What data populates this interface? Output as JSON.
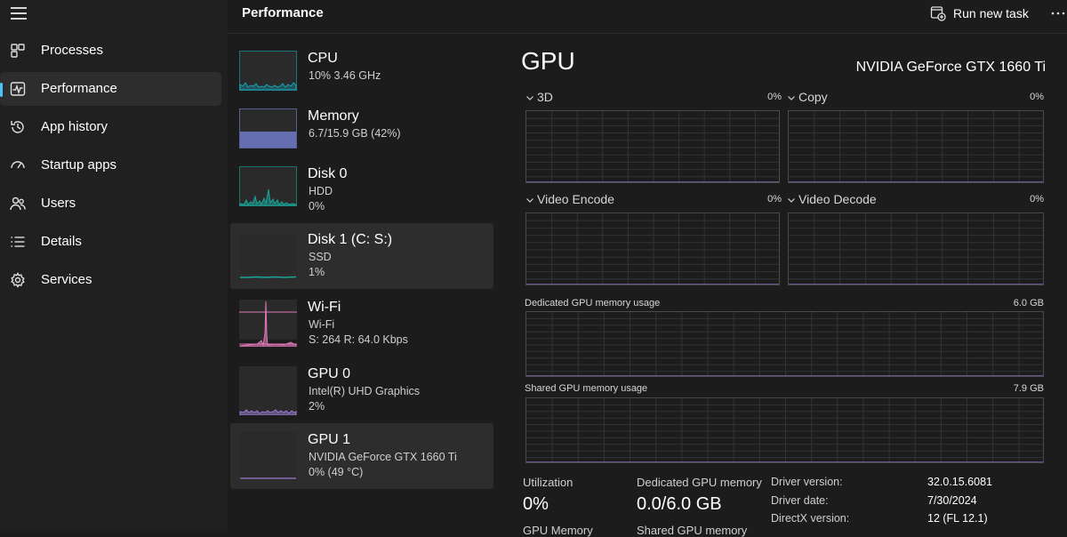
{
  "header": {
    "title": "Performance",
    "run_task_label": "Run new task"
  },
  "nav": {
    "items": [
      {
        "label": "Processes",
        "icon": "processes-icon"
      },
      {
        "label": "Performance",
        "icon": "performance-icon",
        "active": true
      },
      {
        "label": "App history",
        "icon": "app-history-icon"
      },
      {
        "label": "Startup apps",
        "icon": "startup-apps-icon"
      },
      {
        "label": "Users",
        "icon": "users-icon"
      },
      {
        "label": "Details",
        "icon": "details-icon"
      },
      {
        "label": "Services",
        "icon": "services-icon"
      }
    ]
  },
  "devices": [
    {
      "name": "CPU",
      "line1": "10%  3.46 GHz",
      "line2": "",
      "color": "#17a3b8"
    },
    {
      "name": "Memory",
      "line1": "6.7/15.9 GB (42%)",
      "line2": "",
      "color": "#7b86e0",
      "usage_fraction": 0.42
    },
    {
      "name": "Disk 0",
      "line1": "HDD",
      "line2": "0%",
      "color": "#1aa59a"
    },
    {
      "name": "Disk 1 (C: S:)",
      "line1": "SSD",
      "line2": "1%",
      "color": "#1aa59a",
      "selected_style": true
    },
    {
      "name": "Wi-Fi",
      "line1": "Wi-Fi",
      "line2": "S: 264  R: 64.0 Kbps",
      "color": "#e079b8"
    },
    {
      "name": "GPU 0",
      "line1": "Intel(R) UHD Graphics",
      "line2": "2%",
      "color": "#9a7ad0"
    },
    {
      "name": "GPU 1",
      "line1": "NVIDIA GeForce GTX 1660 Ti",
      "line2": "0%  (49 °C)",
      "color": "#9a7ad0",
      "active": true
    }
  ],
  "detail": {
    "title": "GPU",
    "model": "NVIDIA GeForce GTX 1660 Ti",
    "engines": [
      {
        "label": "3D",
        "percent": "0%"
      },
      {
        "label": "Copy",
        "percent": "0%"
      },
      {
        "label": "Video Encode",
        "percent": "0%"
      },
      {
        "label": "Video Decode",
        "percent": "0%"
      }
    ],
    "dedicated": {
      "label": "Dedicated GPU memory usage",
      "max": "6.0 GB"
    },
    "shared": {
      "label": "Shared GPU memory usage",
      "max": "7.9 GB"
    },
    "stats": {
      "utilization_label": "Utilization",
      "utilization_value": "0%",
      "dedicated_label": "Dedicated GPU memory",
      "dedicated_value": "0.0/6.0 GB",
      "gpu_memory_label": "GPU Memory",
      "shared_memory_label": "Shared GPU memory"
    },
    "info": [
      {
        "key": "Driver version:",
        "value": "32.0.15.6081"
      },
      {
        "key": "Driver date:",
        "value": "7/30/2024"
      },
      {
        "key": "DirectX version:",
        "value": "12 (FL 12.1)"
      }
    ],
    "graph_color": "#9a7ad0"
  }
}
